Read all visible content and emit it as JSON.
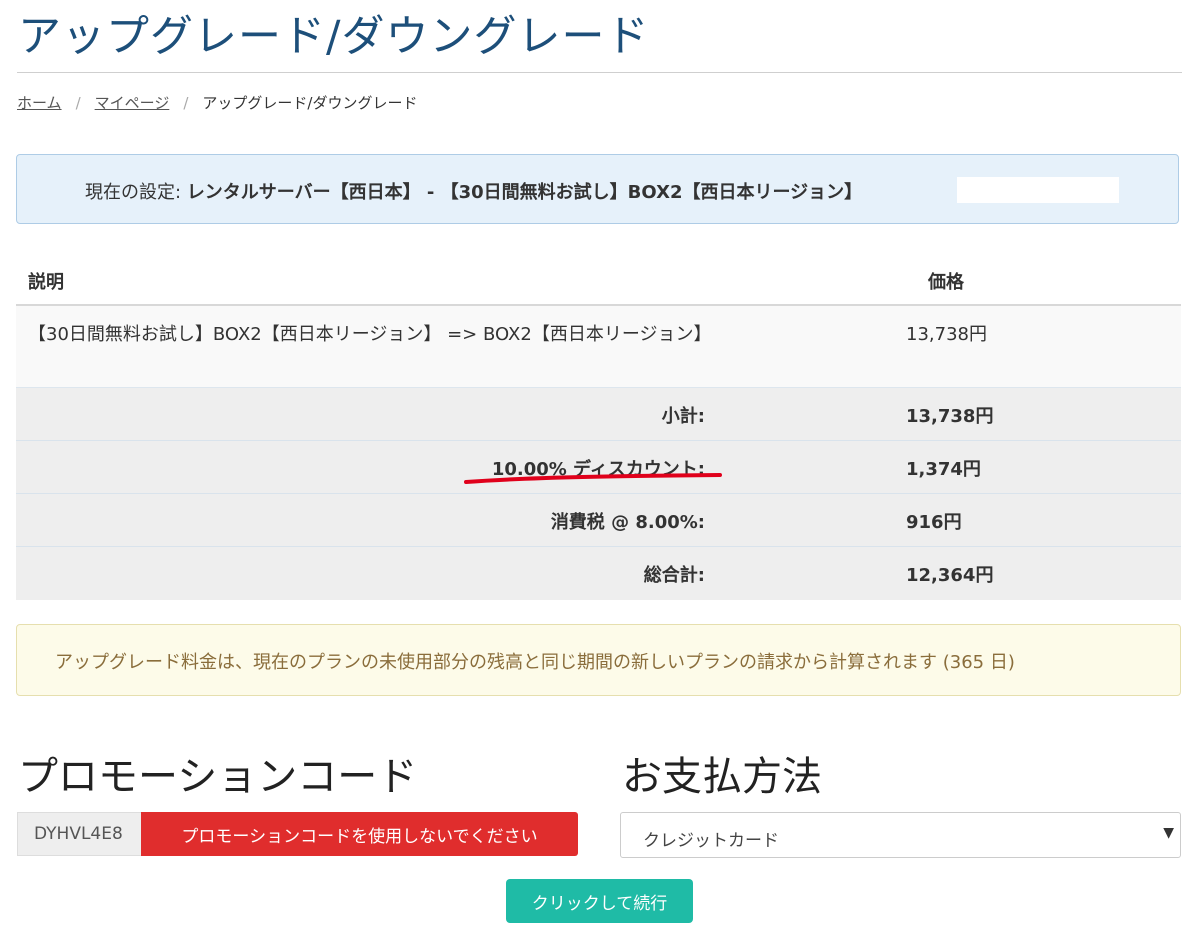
{
  "page": {
    "title": "アップグレード/ダウングレード"
  },
  "breadcrumb": {
    "home": "ホーム",
    "mypage": "マイページ",
    "current": "アップグレード/ダウングレード",
    "separator": "/"
  },
  "current_setting": {
    "label": "現在の設定:",
    "value": "レンタルサーバー【西日本】 - 【30日間無料お試し】BOX2【西日本リージョン】"
  },
  "table": {
    "headers": {
      "description": "説明",
      "price": "価格"
    },
    "item": {
      "description": "【30日間無料お試し】BOX2【西日本リージョン】 => BOX2【西日本リージョン】",
      "price": "13,738円"
    },
    "summary": [
      {
        "label": "小計:",
        "value": "13,738円"
      },
      {
        "label": "10.00% ディスカウント:",
        "value": "1,374円"
      },
      {
        "label": "消費税 @ 8.00%:",
        "value": "916円"
      },
      {
        "label": "総合計:",
        "value": "12,364円"
      }
    ]
  },
  "notice": {
    "text": "アップグレード料金は、現在のプランの未使用部分の残高と同じ期間の新しいプランの請求から計算されます (365 日)"
  },
  "promo": {
    "title": "プロモーションコード",
    "code": "DYHVL4E8",
    "remove_label": "プロモーションコードを使用しないでください"
  },
  "payment": {
    "title": "お支払方法",
    "selected": "クレジットカード"
  },
  "actions": {
    "continue_label": "クリックして続行"
  },
  "colors": {
    "title": "#1d4f7a",
    "remove_button": "#e02d2d",
    "continue_button": "#1fbba6",
    "annotation": "#e0001b"
  }
}
